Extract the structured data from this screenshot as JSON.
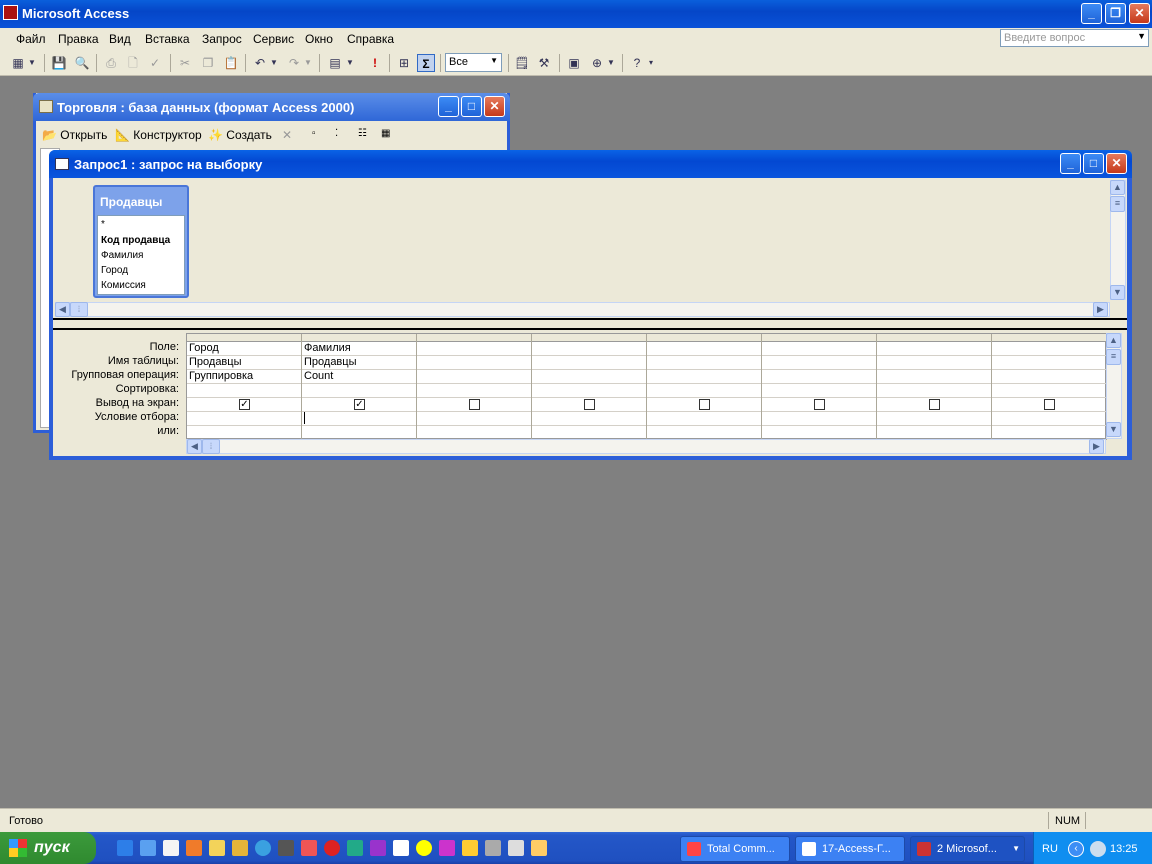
{
  "app": {
    "title": "Microsoft Access"
  },
  "menu": [
    "Файл",
    "Правка",
    "Вид",
    "Вставка",
    "Запрос",
    "Сервис",
    "Окно",
    "Справка"
  ],
  "help_placeholder": "Введите вопрос",
  "toolbar": {
    "top_values": "Все",
    "sigma": "Σ"
  },
  "db_window": {
    "title": "Торговля : база данных (формат Access 2000)",
    "open_label": "Открыть",
    "design_label": "Конструктор",
    "create_label": "Создать"
  },
  "query_window": {
    "title": "Запрос1 : запрос на выборку",
    "table": {
      "name": "Продавцы",
      "fields": [
        "*",
        "Код продавца",
        "Фамилия",
        "Город",
        "Комиссия"
      ]
    },
    "row_labels": [
      "Поле:",
      "Имя таблицы:",
      "Групповая операция:",
      "Сортировка:",
      "Вывод на экран:",
      "Условие отбора:",
      "или:"
    ],
    "columns": [
      {
        "field": "Город",
        "table": "Продавцы",
        "group": "Группировка",
        "show": true
      },
      {
        "field": "Фамилия",
        "table": "Продавцы",
        "group": "Count",
        "show": true
      },
      {
        "field": "",
        "table": "",
        "group": "",
        "show": false
      },
      {
        "field": "",
        "table": "",
        "group": "",
        "show": false
      },
      {
        "field": "",
        "table": "",
        "group": "",
        "show": false
      },
      {
        "field": "",
        "table": "",
        "group": "",
        "show": false
      },
      {
        "field": "",
        "table": "",
        "group": "",
        "show": false
      },
      {
        "field": "",
        "table": "",
        "group": "",
        "show": false
      }
    ]
  },
  "status": {
    "text": "Готово",
    "num": "NUM"
  },
  "taskbar": {
    "start": "пуск",
    "tasks": [
      "Total Comm...",
      "17-Access-Г...",
      "2 Microsof..."
    ],
    "lang": "RU",
    "clock": "13:25"
  }
}
